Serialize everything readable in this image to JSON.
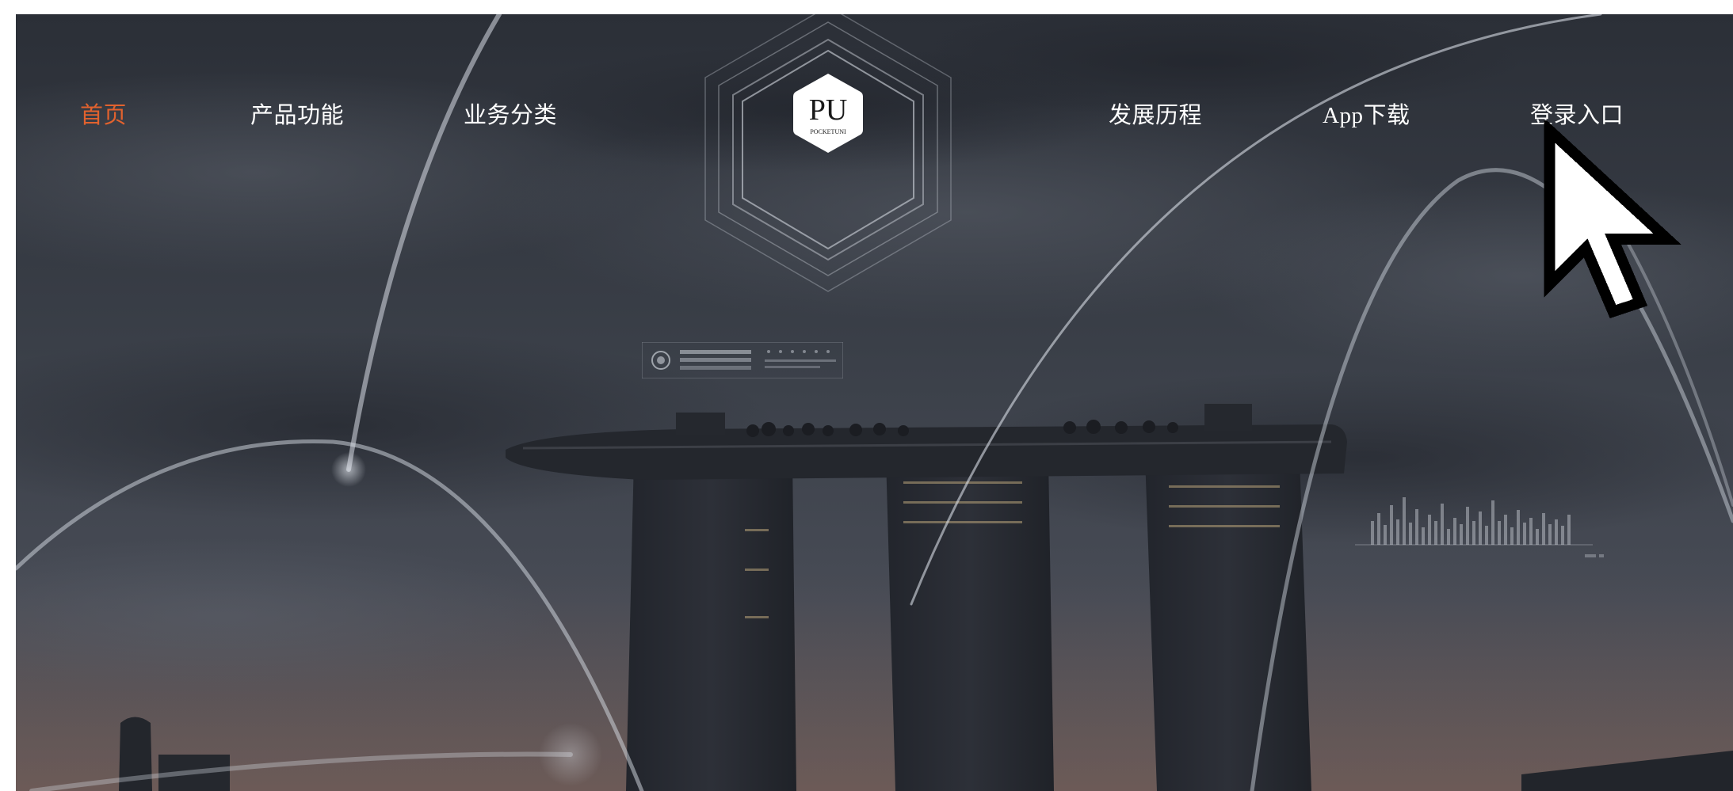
{
  "nav": {
    "home": "首页",
    "products": "产品功能",
    "business": "业务分类",
    "history": "发展历程",
    "app": "App下载",
    "login": "登录入口"
  },
  "logo": {
    "initials": "PU",
    "brand": "POCKETUNI"
  },
  "colors": {
    "active_nav": "#e2622e",
    "nav_text": "#ffffff",
    "overlay": "#2c3039"
  },
  "icons": {
    "pointer": "mouse-pointer-icon"
  }
}
